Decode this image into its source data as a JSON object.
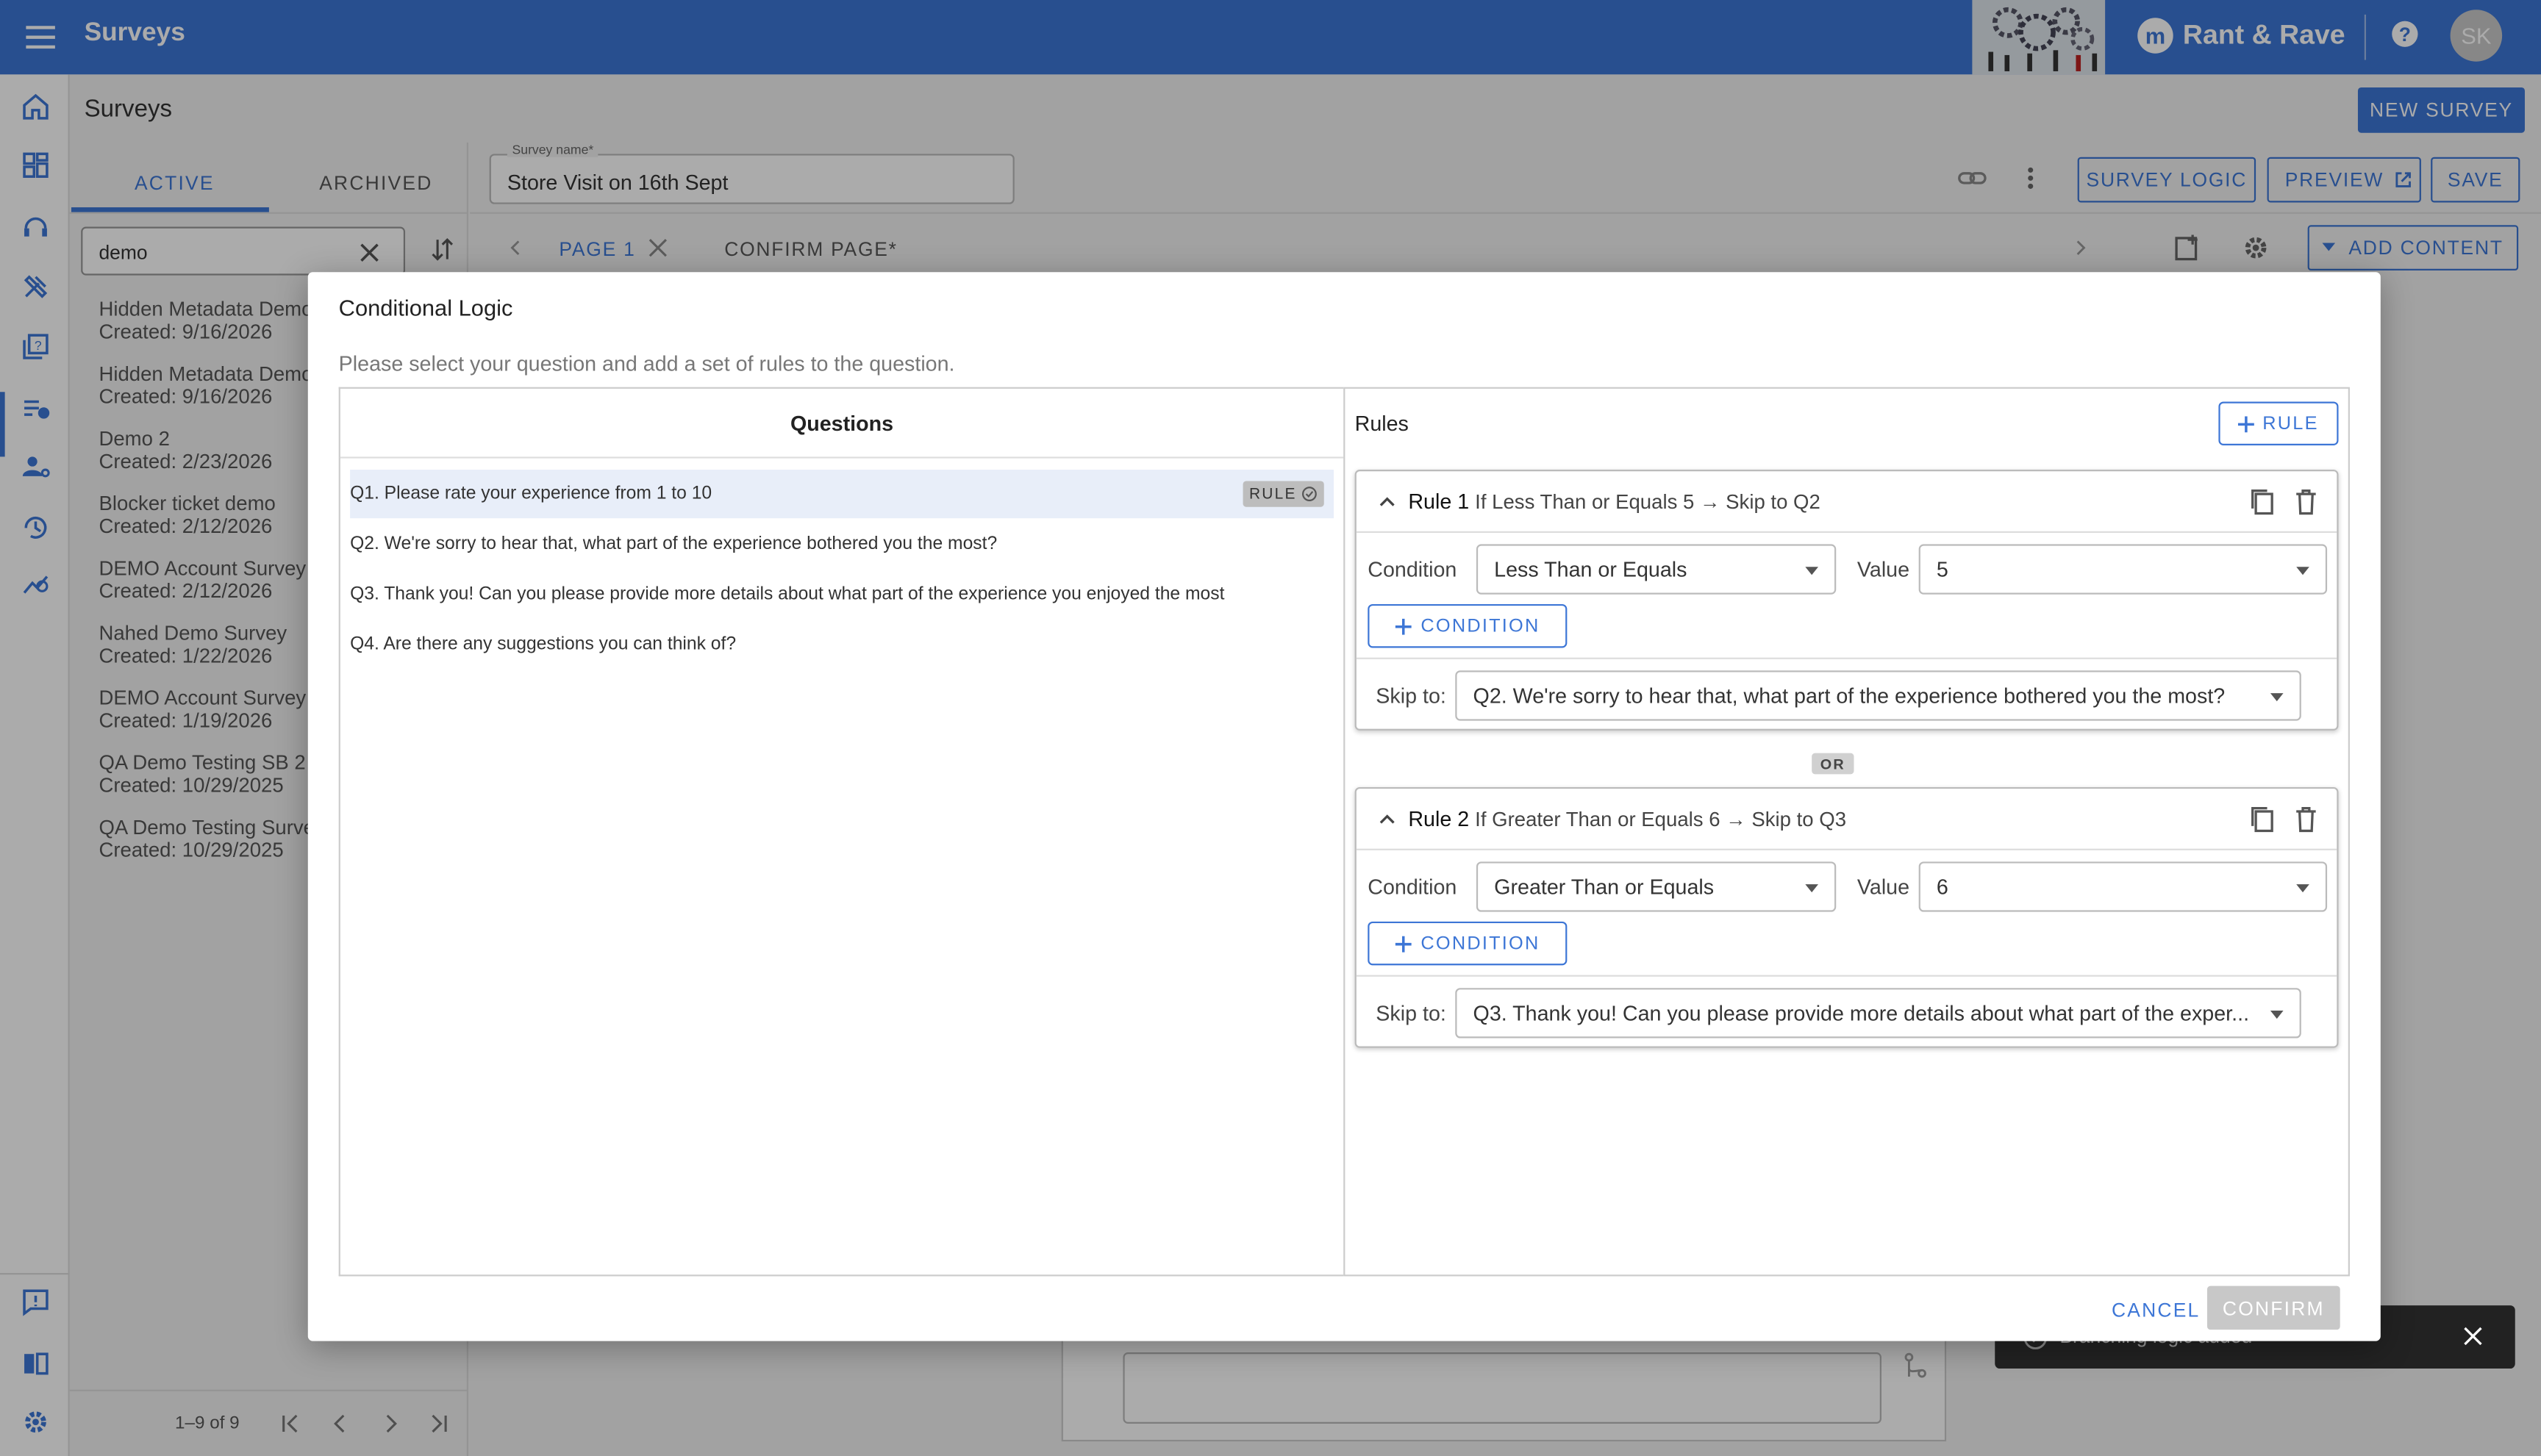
{
  "app": {
    "title": "Surveys",
    "brand": "Rant & Rave",
    "avatar_initials": "SK"
  },
  "header": {
    "page_title": "Surveys",
    "new_survey_label": "NEW SURVEY"
  },
  "sidebar_tabs": {
    "active": "ACTIVE",
    "archived": "ARCHIVED"
  },
  "search": {
    "value": "demo"
  },
  "surveys": [
    {
      "name": "Hidden Metadata Demo",
      "created": "Created: 9/16/2026"
    },
    {
      "name": "Hidden Metadata Demo",
      "created": "Created: 9/16/2026"
    },
    {
      "name": "Demo 2",
      "created": "Created: 2/23/2026"
    },
    {
      "name": "Blocker ticket demo",
      "created": "Created: 2/12/2026"
    },
    {
      "name": "DEMO Account Survey",
      "created": "Created: 2/12/2026"
    },
    {
      "name": "Nahed Demo Survey",
      "created": "Created: 1/22/2026"
    },
    {
      "name": "DEMO Account Survey",
      "created": "Created: 1/19/2026"
    },
    {
      "name": "QA Demo Testing SB 2",
      "created": "Created: 10/29/2025"
    },
    {
      "name": "QA Demo Testing Survey",
      "created": "Created: 10/29/2025"
    }
  ],
  "pagination": {
    "range": "1–9 of 9"
  },
  "editor": {
    "survey_name_label": "Survey name*",
    "survey_name": "Store Visit on 16th Sept",
    "survey_logic_label": "SURVEY LOGIC",
    "preview_label": "PREVIEW",
    "save_label": "SAVE",
    "page_tab": "PAGE 1",
    "confirm_page_tab": "CONFIRM PAGE*",
    "add_content_label": "ADD CONTENT"
  },
  "modal": {
    "title": "Conditional Logic",
    "subtitle": "Please select your question and add a set of rules to the question.",
    "questions_header": "Questions",
    "rules_header": "Rules",
    "add_rule_label": "RULE",
    "rule_chip": "RULE",
    "questions": [
      "Q1. Please rate your experience from 1 to 10",
      "Q2. We're sorry to hear that, what part of the experience bothered you the most?",
      "Q3. Thank you! Can you please provide more details about what part of the experience you enjoyed the most",
      "Q4. Are there any suggestions you can think of?"
    ],
    "rules": [
      {
        "name": "Rule 1",
        "summary": "If Less Than or Equals 5 → Skip to Q2",
        "condition_label": "Condition",
        "condition": "Less Than or Equals",
        "value_label": "Value",
        "value": "5",
        "add_condition_label": "CONDITION",
        "skip_label": "Skip to:",
        "skip_to": "Q2. We're sorry to hear that, what part of the experience bothered you the most?"
      },
      {
        "name": "Rule 2",
        "summary": "If Greater Than or Equals 6 → Skip to Q3",
        "condition_label": "Condition",
        "condition": "Greater Than or Equals",
        "value_label": "Value",
        "value": "6",
        "add_condition_label": "CONDITION",
        "skip_label": "Skip to:",
        "skip_to": "Q3. Thank you! Can you please provide more details about what part of the exper..."
      }
    ],
    "or_label": "OR",
    "cancel_label": "CANCEL",
    "confirm_label": "CONFIRM"
  },
  "toast": {
    "text": "Branching logic added"
  },
  "colors": {
    "primary": "#3d76d6",
    "topbar": "#3d76d6",
    "disabled": "#c8c8c8"
  }
}
